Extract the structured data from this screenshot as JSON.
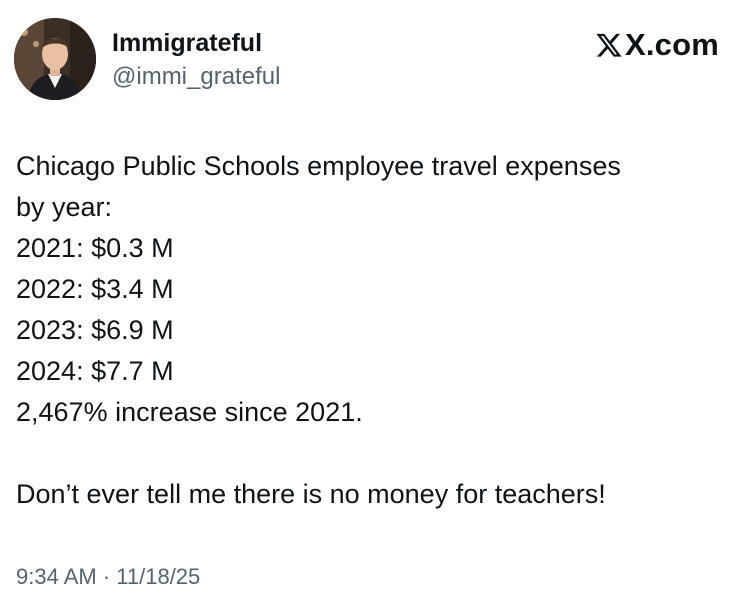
{
  "author": {
    "display_name": "Immigrateful",
    "handle": "@immi_grateful"
  },
  "brand": {
    "text": "X.com",
    "icon": "x-logo-icon"
  },
  "tweet": {
    "lines": [
      "Chicago Public Schools employee travel expenses",
      "by year:",
      "2021: $0.3 M",
      "2022: $3.4 M",
      "2023: $6.9 M",
      "2024: $7.7 M",
      "2,467% increase since 2021.",
      "",
      "Don’t ever tell me there is no money for teachers!"
    ],
    "timestamp": "9:34 AM · 11/18/25"
  },
  "colors": {
    "text_primary": "#0f1419",
    "text_secondary": "#536471",
    "background": "#ffffff"
  }
}
